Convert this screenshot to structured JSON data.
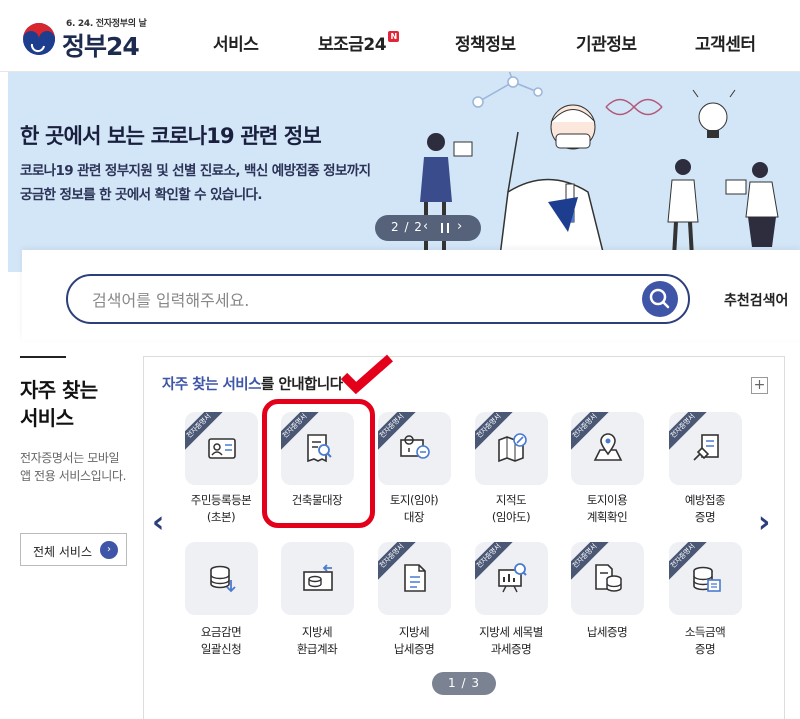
{
  "header": {
    "logo_small": "6. 24. 전자정부의 날",
    "logo_name": "정부24",
    "nav": [
      {
        "label": "서비스"
      },
      {
        "label": "보조금24",
        "badge": "N"
      },
      {
        "label": "정책정보"
      },
      {
        "label": "기관정보"
      },
      {
        "label": "고객센터"
      }
    ]
  },
  "banner": {
    "title": "한 곳에서 보는 코로나19 관련 정보",
    "desc_line1": "코로나19 관련 정부지원 및 선별 진료소, 백신 예방접종 정보까지",
    "desc_line2": "궁금한 정보를 한 곳에서 확인할 수 있습니다.",
    "pager": "2 / 2",
    "bg_color": "#d2e6f8"
  },
  "search": {
    "placeholder": "검색어를 입력해주세요.",
    "value": "",
    "recommend": "추천검색어"
  },
  "side": {
    "title": "자주 찾는 서비스",
    "desc": "전자증명서는 모바일 앱 전용 서비스입니다.",
    "button": "전체 서비스"
  },
  "services": {
    "title_highlight": "자주 찾는 서비스",
    "title_rest": "를 안내합니다",
    "ribbon": "전자증명서",
    "items": [
      {
        "label1": "주민등록등본",
        "label2": "(초본)",
        "icon": "id-card-icon",
        "ribbon": true
      },
      {
        "label1": "건축물대장",
        "label2": "",
        "icon": "document-search-icon",
        "ribbon": true
      },
      {
        "label1": "토지(임야)",
        "label2": "대장",
        "icon": "land-map-icon",
        "ribbon": true
      },
      {
        "label1": "지적도",
        "label2": "(임야도)",
        "icon": "map-compass-icon",
        "ribbon": true
      },
      {
        "label1": "토지이용",
        "label2": "계획확인",
        "icon": "map-pin-icon",
        "ribbon": true
      },
      {
        "label1": "예방접종",
        "label2": "증명",
        "icon": "syringe-doc-icon",
        "ribbon": true
      },
      {
        "label1": "요금감면",
        "label2": "일괄신청",
        "icon": "coins-icon",
        "ribbon": false
      },
      {
        "label1": "지방세",
        "label2": "환급계좌",
        "icon": "tax-refund-icon",
        "ribbon": false
      },
      {
        "label1": "지방세",
        "label2": "납세증명",
        "icon": "tax-doc-icon",
        "ribbon": true
      },
      {
        "label1": "지방세 세목별",
        "label2": "과세증명",
        "icon": "chart-search-icon",
        "ribbon": true
      },
      {
        "label1": "납세증명",
        "label2": "",
        "icon": "tax-coins-icon",
        "ribbon": true
      },
      {
        "label1": "소득금액",
        "label2": "증명",
        "icon": "income-coins-icon",
        "ribbon": true
      }
    ],
    "pager": "1 / 3"
  },
  "colors": {
    "accent": "#3e55a8",
    "navy": "#2c3f7a",
    "highlight": "#e4001b"
  }
}
